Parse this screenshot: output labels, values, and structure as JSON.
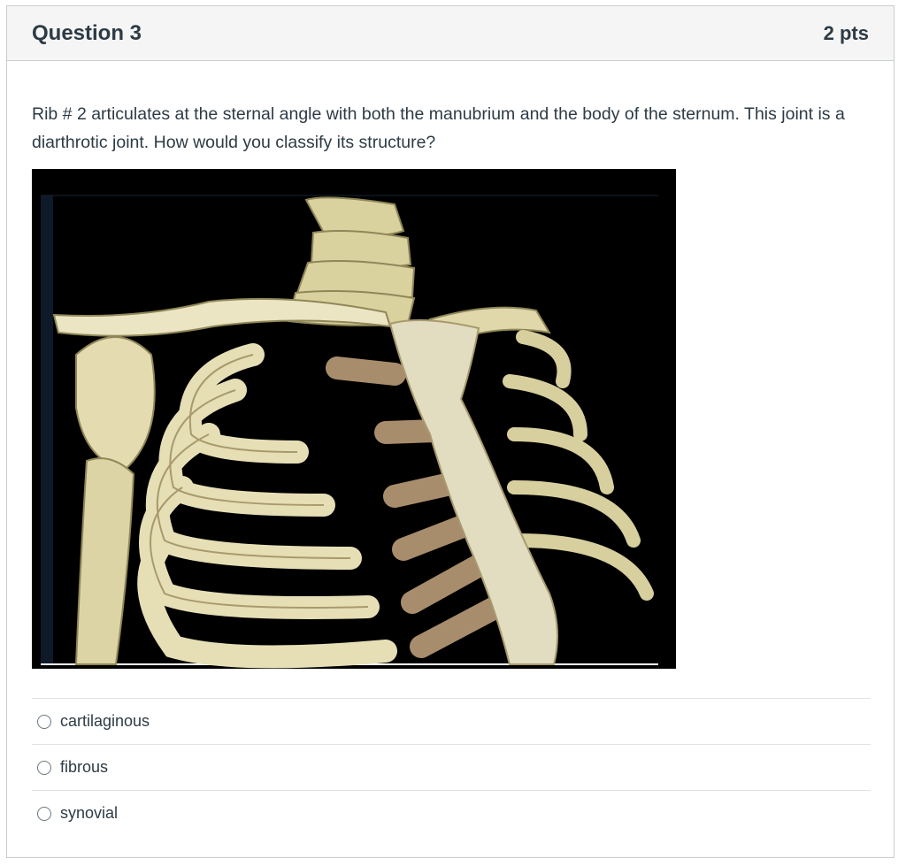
{
  "question": {
    "title": "Question 3",
    "points": "2 pts",
    "text": "Rib # 2 articulates at the sternal angle with both the manubrium and the body of the sternum.  This joint is a diarthrotic joint. How would you classify its structure?",
    "image_subject": "anatomical-skeleton-thorax-photo",
    "answers": [
      {
        "label": "cartilaginous",
        "selected": false
      },
      {
        "label": "fibrous",
        "selected": false
      },
      {
        "label": "synovial",
        "selected": false
      }
    ]
  },
  "colors": {
    "header_bg": "#f5f5f5",
    "border": "#c7cdd1",
    "text": "#2d3b45",
    "bone": "#e9e3bf",
    "cartilage": "#a88d6c",
    "image_bg": "#000000"
  }
}
